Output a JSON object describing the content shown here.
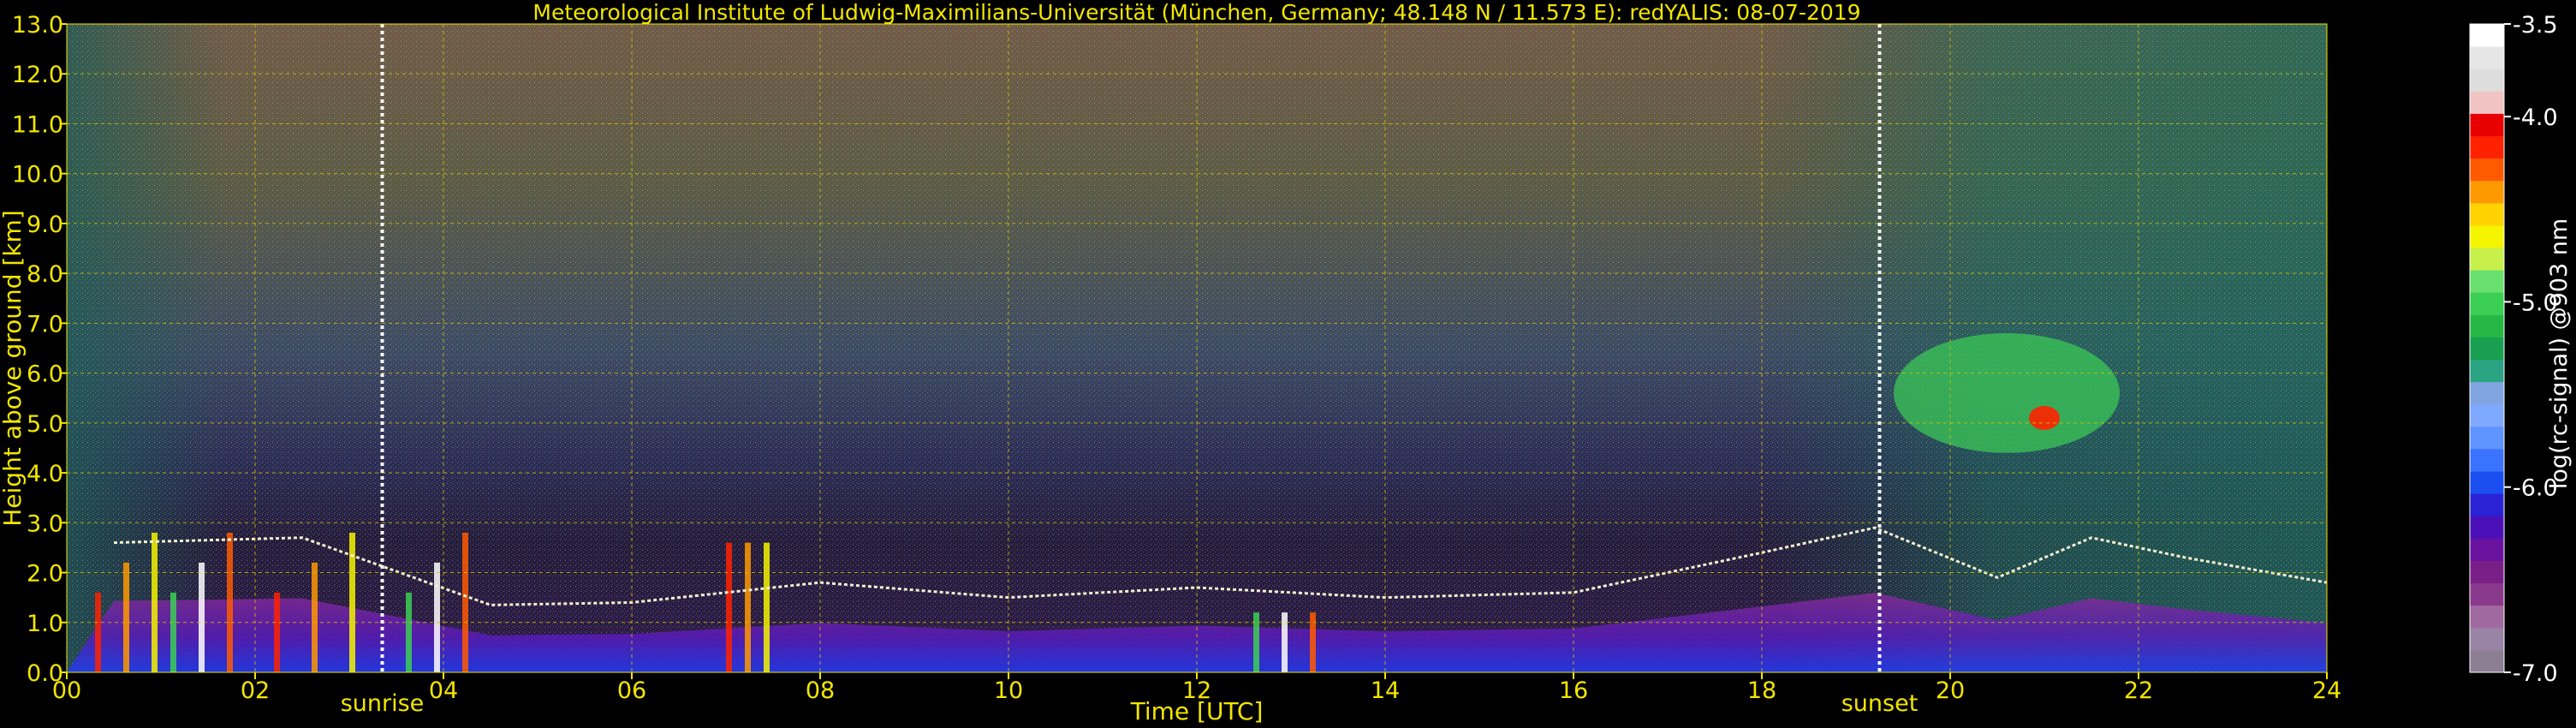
{
  "chart_data": {
    "type": "heatmap",
    "title": "Meteorological Institute of Ludwig-Maximilians-Universität (München, Germany; 48.148 N / 11.573 E):    redYALIS: 08-07-2019",
    "xlabel": "Time [UTC]",
    "ylabel": "Height above ground [km]",
    "xlim": [
      0,
      24
    ],
    "ylim": [
      0,
      13
    ],
    "xticks": [
      "00",
      "02",
      "04",
      "06",
      "08",
      "10",
      "12",
      "14",
      "16",
      "18",
      "20",
      "22",
      "24"
    ],
    "yticks": [
      "0.0",
      "1.0",
      "2.0",
      "3.0",
      "4.0",
      "5.0",
      "6.0",
      "7.0",
      "8.0",
      "9.0",
      "10.0",
      "11.0",
      "12.0",
      "13.0"
    ],
    "grid": true,
    "markers": [
      {
        "label": "sunrise",
        "x": 3.35
      },
      {
        "label": "sunset",
        "x": 19.25
      }
    ],
    "colorbar": {
      "label": "log(rc-signal) @903 nm",
      "range": [
        -7.0,
        -3.5
      ],
      "ticks": [
        "-3.5",
        "-4.0",
        "-5.0",
        "-6.0",
        "-7.0"
      ],
      "colors": [
        "#8c7f93",
        "#9a84a6",
        "#a06aa0",
        "#8a3a8c",
        "#7a1f88",
        "#6a12a0",
        "#4b10b8",
        "#2a22d4",
        "#1a4ef0",
        "#3a73ff",
        "#5f93ff",
        "#7fa9ff",
        "#80a5e0",
        "#2aa383",
        "#18a050",
        "#25b845",
        "#3ccf55",
        "#69e070",
        "#c8f04a",
        "#f5f500",
        "#ffd200",
        "#ff9900",
        "#ff5a00",
        "#ff2200",
        "#e80000",
        "#f1c4c4",
        "#dddddd",
        "#e6e6e6",
        "#ffffff"
      ]
    },
    "features": [
      {
        "name": "boundary layer top",
        "x": [
          0.5,
          2.5,
          4.5,
          6,
          8,
          10,
          12,
          14,
          16,
          18,
          19.2,
          20.5,
          21.5,
          22.5,
          24
        ],
        "y": [
          2.6,
          2.7,
          1.35,
          1.4,
          1.8,
          1.5,
          1.7,
          1.5,
          1.6,
          2.4,
          2.9,
          1.9,
          2.7,
          2.3,
          1.8
        ]
      },
      {
        "name": "elevated cloud layer",
        "x": [
          19.8,
          20.5,
          21.3
        ],
        "y": [
          5.1,
          6.5,
          4.8
        ]
      }
    ]
  }
}
